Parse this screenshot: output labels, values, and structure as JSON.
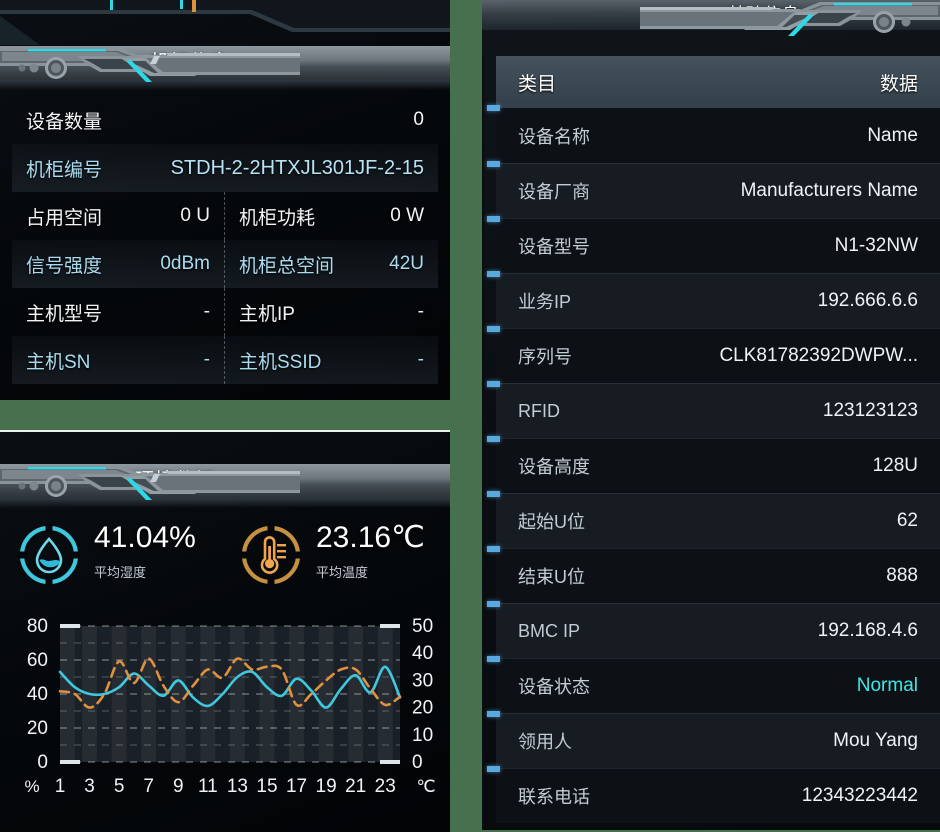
{
  "theme": {
    "accent_cyan": "#3fe6e6",
    "label_cyan": "#a9dcf0",
    "humidity_color": "#3fc8dd",
    "temperature_color": "#e0913f",
    "background_green": "#47704f"
  },
  "cabinet_panel": {
    "title": "机柜信息",
    "rows": [
      {
        "style": "plain",
        "cells": [
          {
            "label": "设备数量",
            "value": "0"
          }
        ]
      },
      {
        "style": "alt",
        "cells": [
          {
            "label": "机柜编号",
            "value": "STDH-2-2HTXJL301JF-2-15"
          }
        ]
      },
      {
        "style": "plain",
        "cells": [
          {
            "label": "占用空间",
            "value": "0 U"
          },
          {
            "label": "机柜功耗",
            "value": "0 W"
          }
        ]
      },
      {
        "style": "alt",
        "cells": [
          {
            "label": "信号强度",
            "value": "0dBm"
          },
          {
            "label": "机柜总空间",
            "value": "42U"
          }
        ]
      },
      {
        "style": "plain",
        "cells": [
          {
            "label": "主机型号",
            "value": "-"
          },
          {
            "label": "主机IP",
            "value": "-"
          }
        ]
      },
      {
        "style": "alt",
        "cells": [
          {
            "label": "主机SN",
            "value": "-"
          },
          {
            "label": "主机SSID",
            "value": "-"
          }
        ]
      }
    ]
  },
  "environment_panel": {
    "title": "环境数据",
    "gauges": [
      {
        "icon": "water-drop-icon",
        "value": "41.04%",
        "caption": "平均湿度",
        "color": "#3fc8dd"
      },
      {
        "icon": "thermometer-icon",
        "value": "23.16℃",
        "caption": "平均温度",
        "color": "#e0913f"
      }
    ]
  },
  "chart_data": {
    "type": "line",
    "title": "环境数据",
    "xlabel": "",
    "ylabel": "%",
    "y2label": "℃",
    "x": [
      1,
      2,
      3,
      4,
      5,
      6,
      7,
      8,
      9,
      10,
      11,
      12,
      13,
      14,
      15,
      16,
      17,
      18,
      19,
      20,
      21,
      22,
      23,
      24
    ],
    "xtick_labels": [
      "1",
      "3",
      "5",
      "7",
      "9",
      "11",
      "13",
      "15",
      "17",
      "19",
      "21",
      "23"
    ],
    "ylim": [
      0,
      80
    ],
    "yticks": [
      0,
      20,
      40,
      60,
      80
    ],
    "y2lim": [
      0,
      50
    ],
    "y2ticks": [
      0,
      10,
      20,
      30,
      40,
      50
    ],
    "grid": true,
    "legend": "none",
    "series": [
      {
        "name": "平均湿度",
        "axis": "left",
        "unit": "%",
        "color": "#3fc8dd",
        "style": "solid",
        "values": [
          53,
          44,
          40,
          40,
          44,
          52,
          45,
          39,
          48,
          38,
          33,
          40,
          50,
          53,
          44,
          39,
          49,
          42,
          32,
          43,
          51,
          41,
          56,
          38
        ]
      },
      {
        "name": "平均温度",
        "axis": "right",
        "unit": "℃",
        "color": "#e0913f",
        "style": "dashed",
        "values": [
          26,
          25,
          20,
          25,
          37,
          29,
          38,
          28,
          22,
          28,
          34,
          31,
          38,
          34,
          35,
          34,
          21,
          25,
          30,
          34,
          34,
          27,
          21,
          24
        ]
      }
    ]
  },
  "base_panel": {
    "title": "基础信息",
    "columns": [
      "类目",
      "数据"
    ],
    "rows": [
      {
        "key": "设备名称",
        "value": "Name"
      },
      {
        "key": "设备厂商",
        "value": "Manufacturers Name"
      },
      {
        "key": "设备型号",
        "value": "N1-32NW"
      },
      {
        "key": "业务IP",
        "value": "192.666.6.6"
      },
      {
        "key": "序列号",
        "value": "CLK81782392DWPW..."
      },
      {
        "key": "RFID",
        "value": "123123123"
      },
      {
        "key": "设备高度",
        "value": "128U"
      },
      {
        "key": "起始U位",
        "value": "62"
      },
      {
        "key": "结束U位",
        "value": "888"
      },
      {
        "key": "BMC IP",
        "value": "192.168.4.6"
      },
      {
        "key": "设备状态",
        "value": "Normal",
        "accent": true
      },
      {
        "key": "领用人",
        "value": "Mou Yang"
      },
      {
        "key": "联系电话",
        "value": "12343223442"
      }
    ]
  }
}
